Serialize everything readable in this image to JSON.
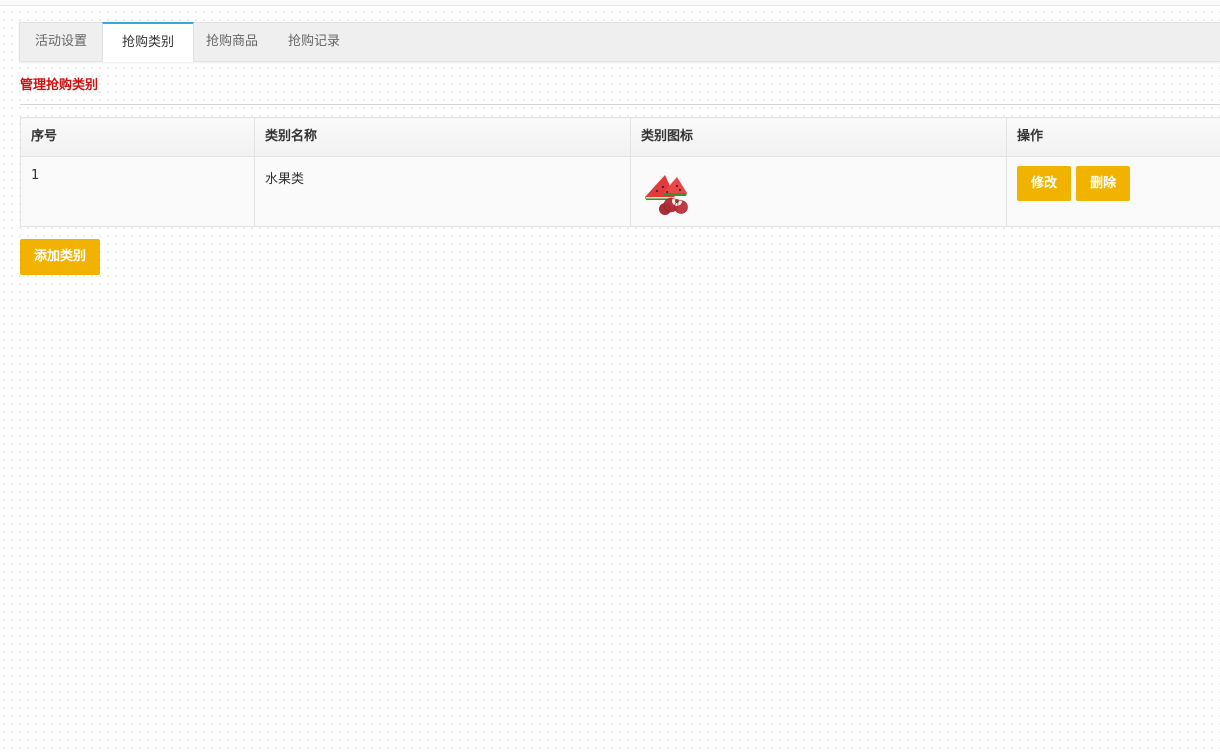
{
  "tabs": [
    {
      "label": "活动设置",
      "active": false
    },
    {
      "label": "抢购类别",
      "active": true
    },
    {
      "label": "抢购商品",
      "active": false
    },
    {
      "label": "抢购记录",
      "active": false
    }
  ],
  "section_title": "管理抢购类别",
  "table": {
    "headers": [
      "序号",
      "类别名称",
      "类别图标",
      "操作"
    ],
    "rows": [
      {
        "no": "1",
        "name": "水果类",
        "icon": "watermelon-lychee-image"
      }
    ]
  },
  "actions": {
    "edit_label": "修改",
    "delete_label": "删除"
  },
  "add_button_label": "添加类别",
  "colors": {
    "accent_button": "#f2b200",
    "title_red": "#cc1111",
    "active_tab_border": "#3aa8e0"
  }
}
